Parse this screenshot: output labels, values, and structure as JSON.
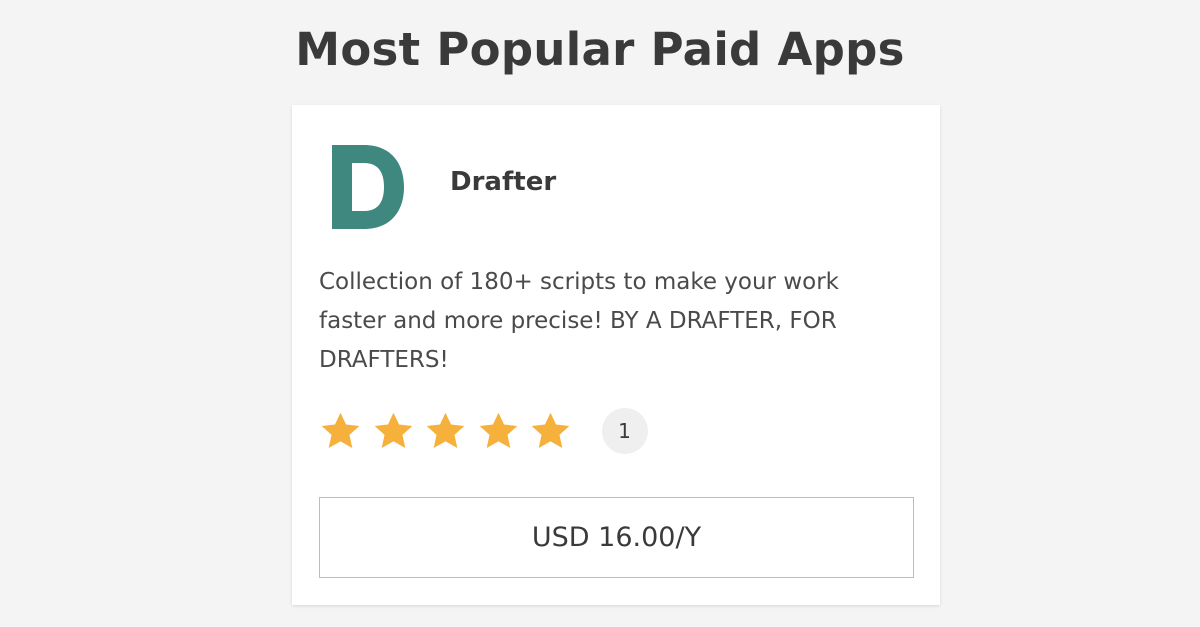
{
  "page": {
    "title": "Most Popular Paid Apps"
  },
  "app": {
    "logo_letter": "D",
    "logo_color": "#3f8880",
    "name": "Drafter",
    "description": "Collection of 180+ scripts to make your work faster and more precise! BY A DRAFTER, FOR DRAFTERS!",
    "rating": 5,
    "rating_max": 5,
    "star_color": "#f6b03c",
    "review_count": "1",
    "price_label": "USD 16.00/Y"
  },
  "icons": {
    "logo": "letter-d-logo",
    "star": "star-icon"
  }
}
